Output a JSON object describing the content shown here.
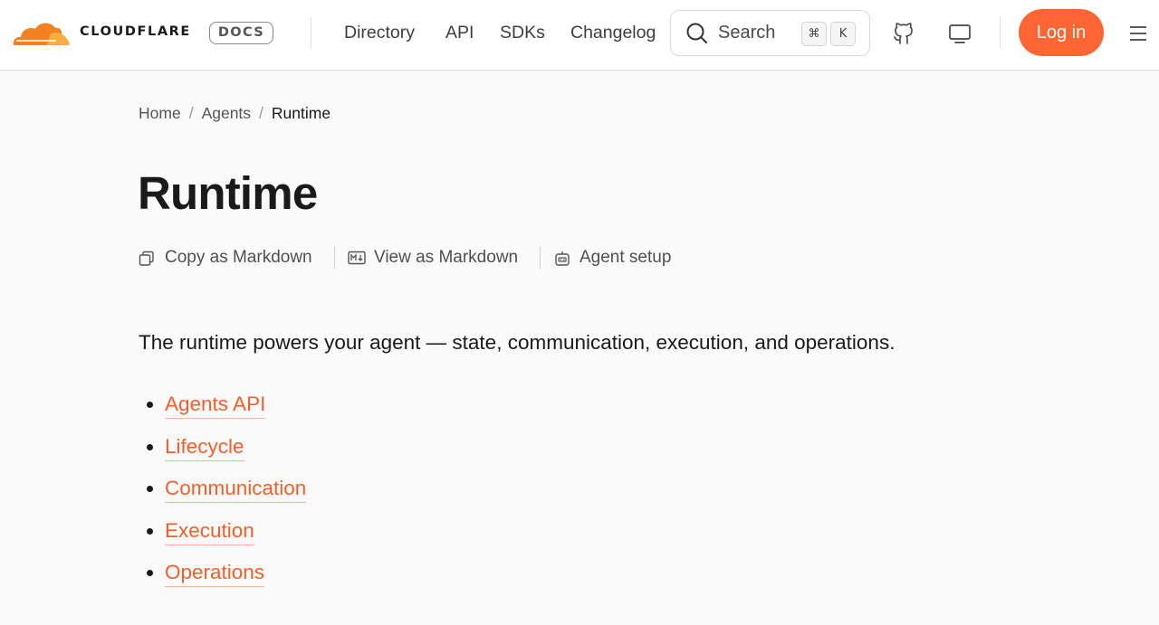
{
  "header": {
    "brand": "CLOUDFLARE",
    "badge": "DOCS",
    "nav": [
      "Directory",
      "API",
      "SDKs",
      "Changelog"
    ],
    "search": {
      "label": "Search",
      "shortcut": [
        "⌘",
        "K"
      ]
    },
    "login_label": "Log in",
    "icons": [
      "github-icon",
      "monitor-icon",
      "menu-icon"
    ]
  },
  "breadcrumb": {
    "items": [
      "Home",
      "Agents"
    ],
    "current": "Runtime",
    "separator": "/"
  },
  "page": {
    "title": "Runtime",
    "actions": [
      {
        "label": "Copy as Markdown",
        "icon": "copy-icon"
      },
      {
        "label": "View as Markdown",
        "icon": "markdown-icon"
      },
      {
        "label": "Agent setup",
        "icon": "robot-icon"
      }
    ],
    "intro": "The runtime powers your agent — state, communication, execution, and operations.",
    "links": [
      "Agents API",
      "Lifecycle",
      "Communication",
      "Execution",
      "Operations"
    ]
  },
  "colors": {
    "accent": "#ff6633",
    "link": "#f25f2c",
    "background": "#fafafa"
  }
}
